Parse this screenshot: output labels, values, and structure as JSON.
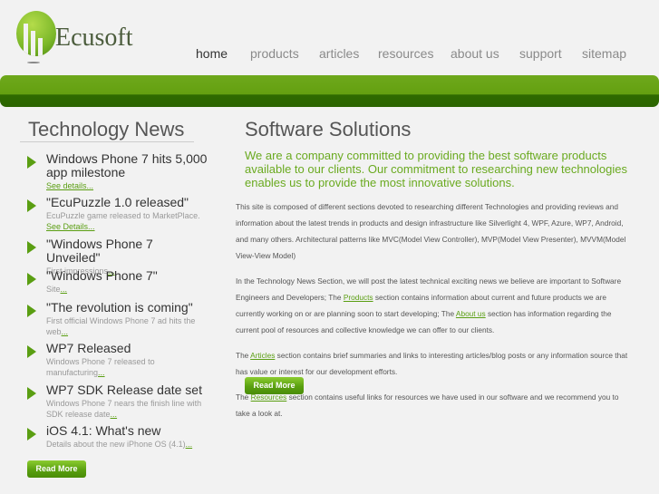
{
  "brand": "Ecusoft",
  "nav": [
    "home",
    "products",
    "articles",
    "resources",
    "about us",
    "support",
    "sitemap"
  ],
  "left": {
    "title": "Technology News",
    "items": [
      {
        "title": "Windows Phone 7 hits 5,000 app milestone",
        "desc": "",
        "link": "See details..."
      },
      {
        "title": "\"EcuPuzzle 1.0 released\"",
        "desc": "EcuPuzzle game released to MarketPlace. ",
        "link": "See Details..."
      },
      {
        "title": "\"Windows Phone 7 Unveiled\"",
        "desc": "First impressions",
        "link": "..."
      },
      {
        "title": "\"Windows Phone 7\"",
        "desc": "Site",
        "link": "..."
      },
      {
        "title": "\"The revolution is coming\"",
        "desc": "First official Windows Phone 7 ad hits the web",
        "link": "..."
      },
      {
        "title": "WP7 Released",
        "desc": "Windows Phone 7 released to manufacturing",
        "link": "..."
      },
      {
        "title": "WP7 SDK Release date set",
        "desc": "Windows Phone 7 nears the finish line with SDK release date",
        "link": "..."
      },
      {
        "title": "iOS 4.1: What's new",
        "desc": "Details about the new iPhone OS (4.1)",
        "link": "..."
      }
    ],
    "button": "Read More"
  },
  "right": {
    "title": "Software Solutions",
    "intro": "We are a company committed to providing the best software products available to our clients. Our commitment to researching new technologies enables us to provide the most innovative solutions.",
    "p1": "This site is composed of different sections devoted to researching different Technologies and providing reviews and information about the latest trends in products and design infrastructure like Silverlight 4, WPF, Azure, WP7, Android, and many others. Architectural patterns like MVC(Model View Controller), MVP(Model View Presenter), MVVM(Model View-View Model)",
    "p2a": "In the Technology News Section, we will post the latest technical exciting news we believe are important to Software Engineers and Developers; The ",
    "p2link1": "Products",
    "p2b": " section contains information about current and future products we are currently working on or are planning soon to start developing; The ",
    "p2link2": "About us",
    "p2c": " section has information regarding the current pool of resources and collective knowledge we can offer to our clients.",
    "p3a": "The ",
    "p3link": "Articles",
    "p3b": " section contains brief summaries and links to interesting articles/blog posts or any information source that has value or interest for our development efforts.",
    "p4a": "The ",
    "p4link": "Resources",
    "p4b": " section contains useful links for resources we have used in our software and we recommend you to take a look at.",
    "button": "Read More"
  }
}
